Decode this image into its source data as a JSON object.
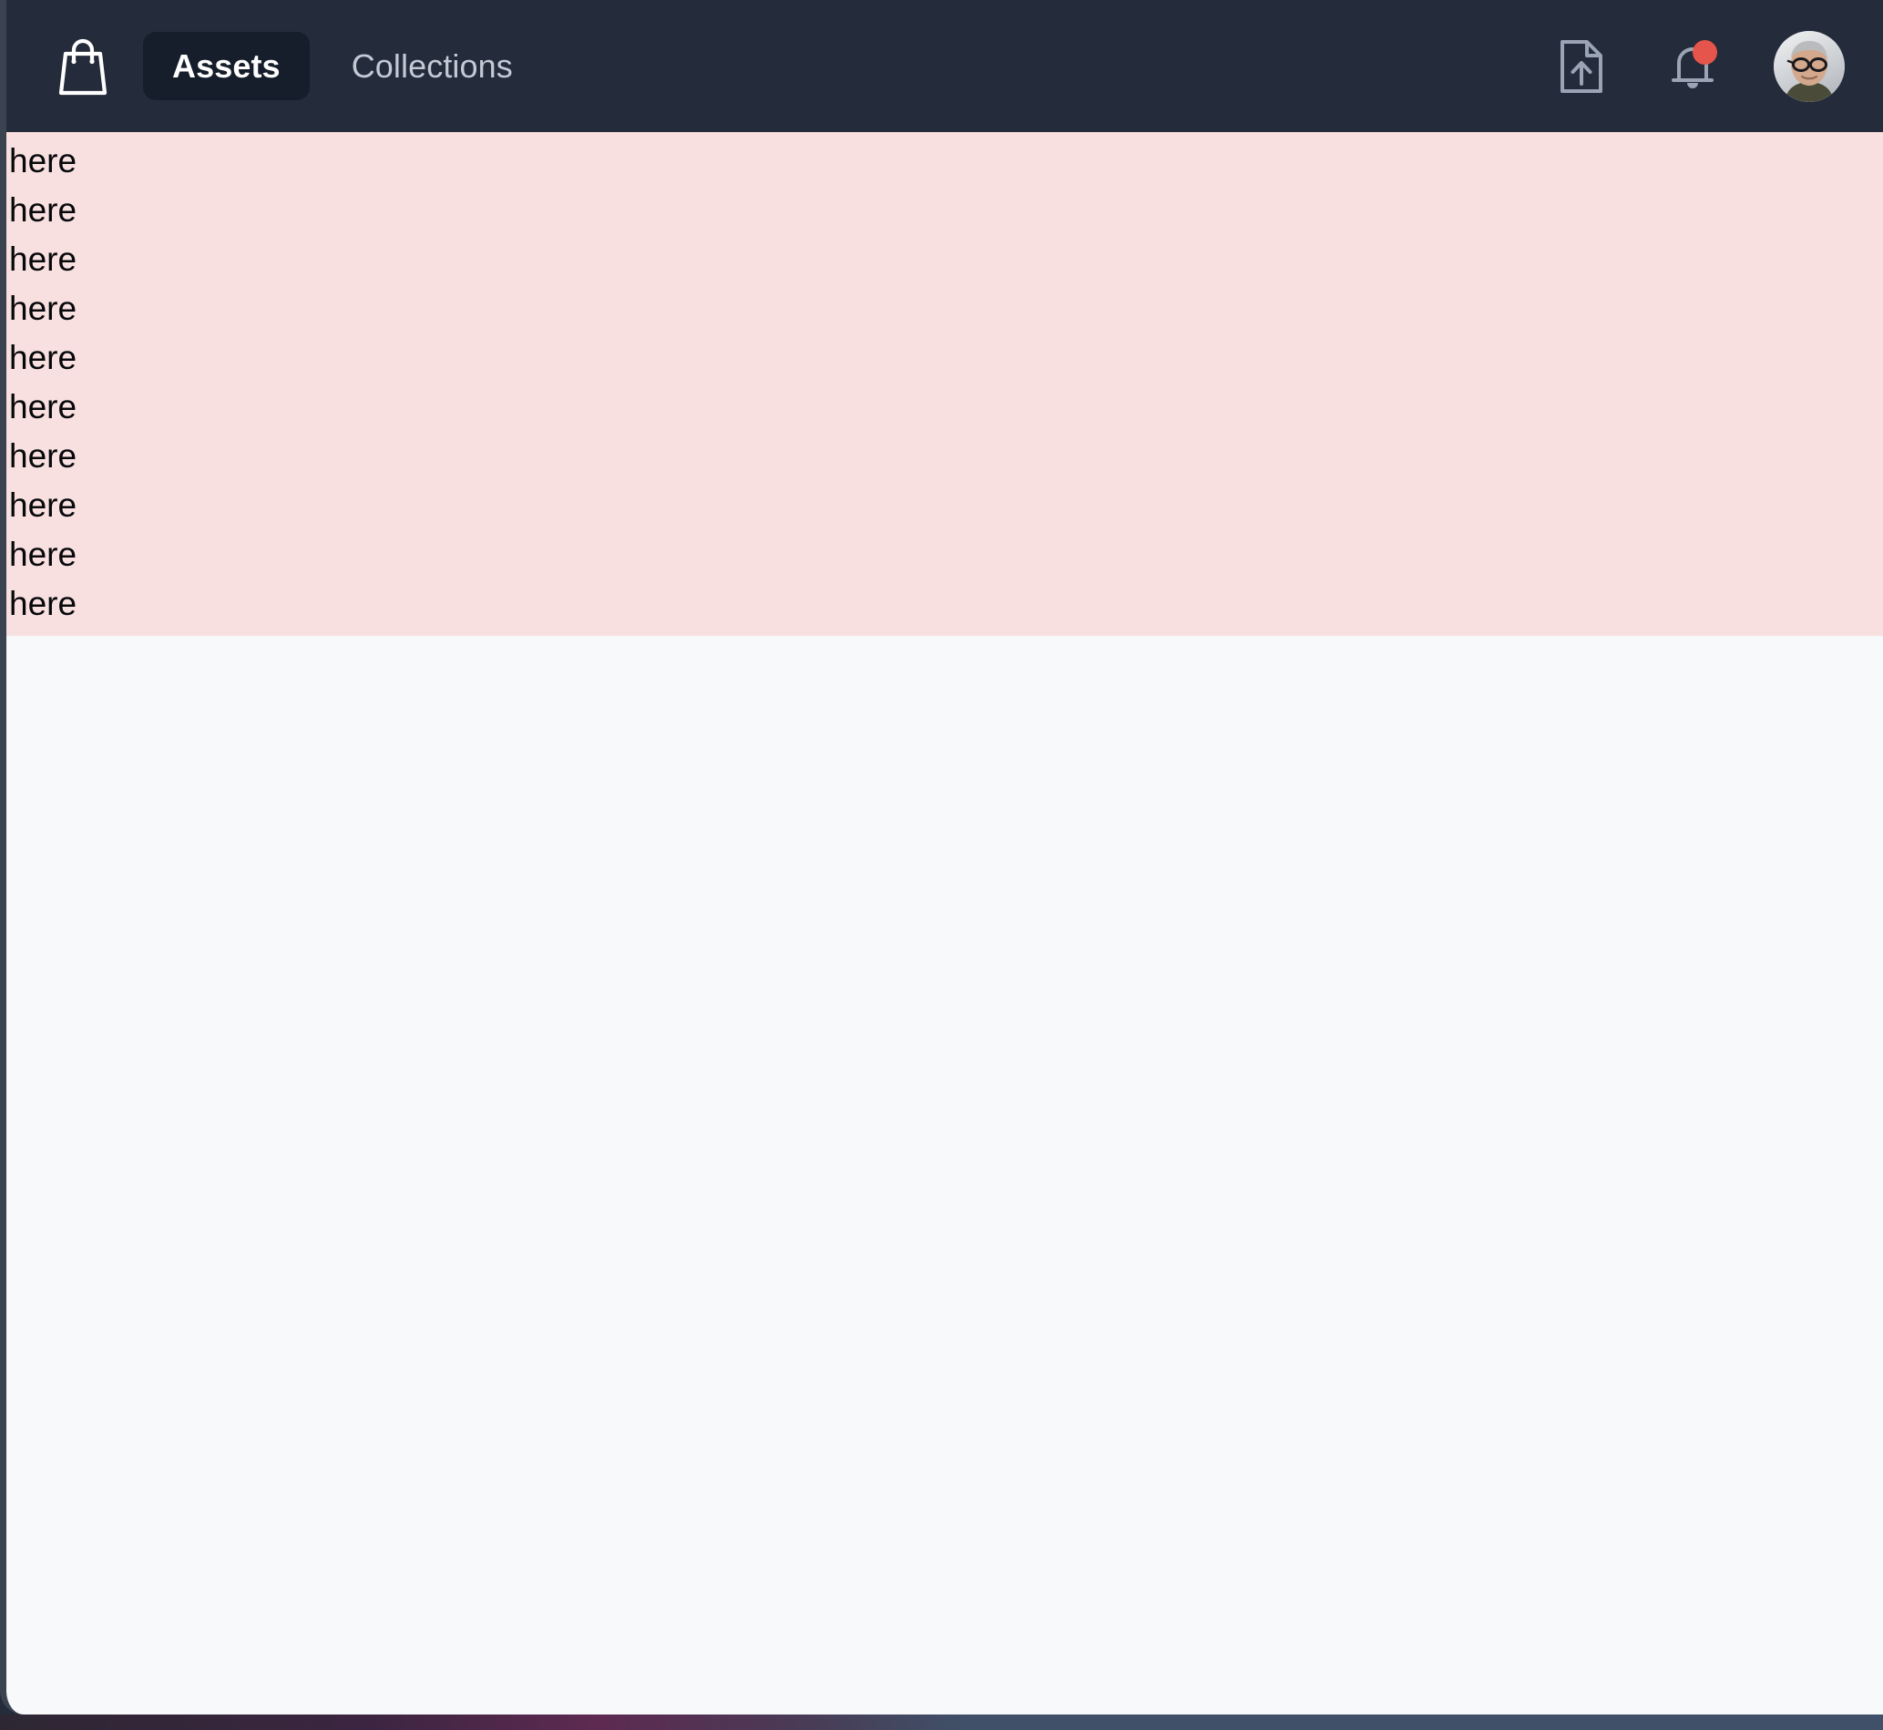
{
  "app": {
    "logo_icon": "shopping-bag-icon",
    "background_color": "#242b3a",
    "surface_color": "#f7f9fb"
  },
  "header": {
    "brand_label": "Shopping Bag",
    "tabs": [
      {
        "label": "Assets",
        "active": true
      },
      {
        "label": "Collections",
        "active": false
      }
    ],
    "actions": [
      {
        "name": "upload-file-icon",
        "label": "Upload file"
      },
      {
        "name": "notifications-bell-icon",
        "label": "Notifications",
        "has_badge": true,
        "badge_color": "#e5554b"
      },
      {
        "name": "avatar",
        "label": "User profile"
      }
    ]
  },
  "alert": {
    "background_color": "#f8e0e0",
    "text_color": "#07080b",
    "lines": [
      "here",
      "here",
      "here",
      "here",
      "here",
      "here",
      "here",
      "here",
      "here",
      "here"
    ]
  }
}
